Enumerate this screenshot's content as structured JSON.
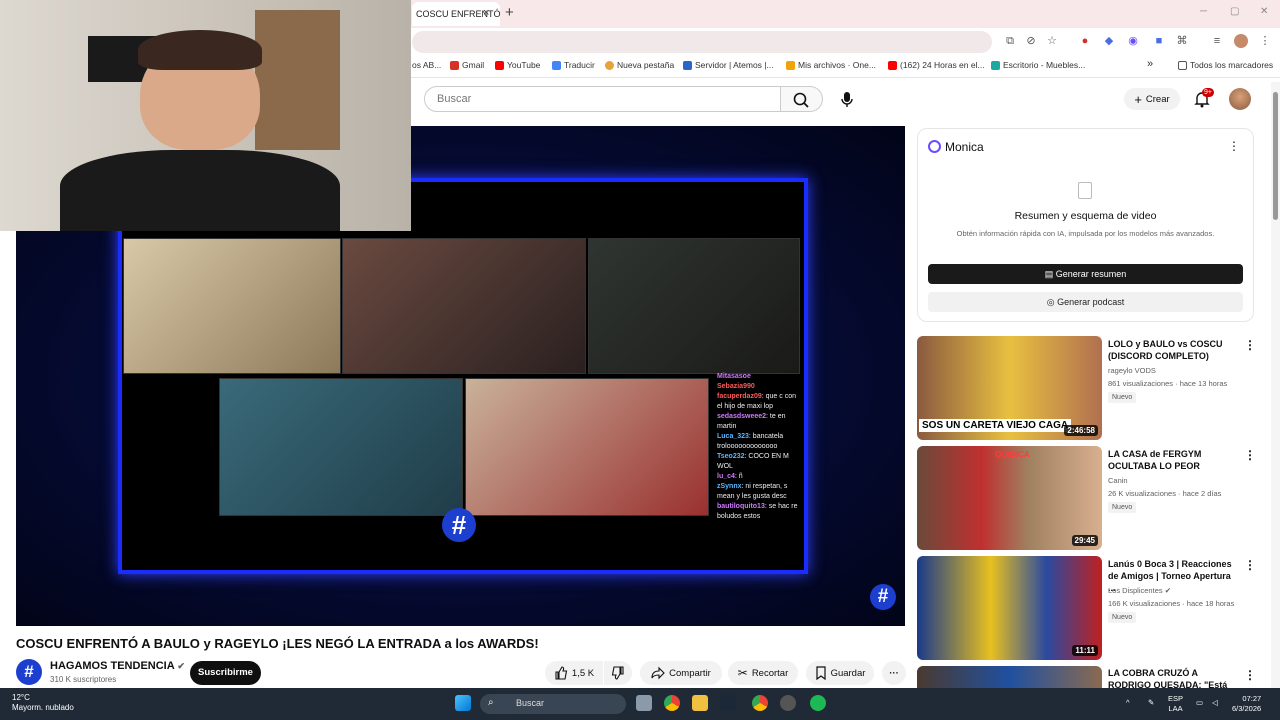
{
  "browser": {
    "tab_title": "COSCU ENFRENTÓ A BAULO",
    "tab_close": "×",
    "new_tab": "+",
    "bookmarks": [
      {
        "label": "os AB...",
        "color": "#888"
      },
      {
        "label": "Gmail",
        "color": "#d93025"
      },
      {
        "label": "YouTube",
        "color": "#ff0000"
      },
      {
        "label": "Traducir",
        "color": "#4285f4"
      },
      {
        "label": "Nueva pestaña",
        "color": "#e8a23a"
      },
      {
        "label": "Servidor | Atemos |...",
        "color": "#2b65c9"
      },
      {
        "label": "Mis archivos · One...",
        "color": "#f0a30a"
      },
      {
        "label": "(162) 24 Horas en el...",
        "color": "#ff0000"
      },
      {
        "label": "Escritorio - Muebles...",
        "color": "#19a9a0"
      }
    ],
    "bookmarks_more": "»",
    "all_bookmarks": "Todos los marcadores"
  },
  "youtube": {
    "search_placeholder": "Buscar",
    "create_label": "Crear",
    "notif_badge": "9+"
  },
  "video": {
    "title": "COSCU ENFRENTÓ A BAULO y RAGEYLO ¡LES NEGÓ LA ENTRADA a los AWARDS!",
    "logo_glyph": "#",
    "chat": [
      {
        "name": "Mitasasoe",
        "cls": "n",
        "text": ""
      },
      {
        "name": "Sebazia990",
        "cls": "n2",
        "text": ""
      },
      {
        "name": "facuperdaz09",
        "cls": "n2",
        "text": ": que c con el hijo de maxi lop"
      },
      {
        "name": "sedasdsweee2",
        "cls": "n",
        "text": ": te en martin"
      },
      {
        "name": "Luca_323",
        "cls": "n3",
        "text": ": bancatela trolooooooooooooo"
      },
      {
        "name": "Tseo232",
        "cls": "n3",
        "text": ": COCO EN M WOL"
      },
      {
        "name": "lu_c4",
        "cls": "n",
        "text": ": ñ"
      },
      {
        "name": "zSynnx",
        "cls": "n3",
        "text": ": ni respetan, s mean y les gusta desc"
      },
      {
        "name": "bautiloquito13",
        "cls": "n",
        "text": ": se hac re boludos estos"
      }
    ]
  },
  "channel": {
    "avatar_glyph": "#",
    "name": "HAGAMOS TENDENCIA",
    "verified": "✔",
    "subs": "310 K suscriptores",
    "subscribe": "Suscribirme"
  },
  "actions": {
    "likes": "1,5 K",
    "share": "Compartir",
    "clip": "Recortar",
    "save": "Guardar",
    "more": "···"
  },
  "monica": {
    "title": "Monica",
    "menu": "⋮",
    "heading": "Resumen y esquema de video",
    "subheading": "Obtén información rápida con IA, impulsada por los modelos más avanzados.",
    "gen_summary": "Generar resumen",
    "gen_podcast": "Generar podcast"
  },
  "recommendations": [
    {
      "title": "LOLO y BAULO vs COSCU (DISCORD COMPLETO)",
      "channel": "rageylo VODS",
      "meta": "861 visualizaciones · hace 13 horas",
      "badge": "Nuevo",
      "duration": "2:46:58",
      "overlay": "SOS UN CARETA   VIEJO CAGA"
    },
    {
      "title": "LA CASA de FERGYM OCULTABA LO PEOR",
      "channel": "Canin",
      "meta": "26 K visualizaciones · hace 2 días",
      "badge": "Nuevo",
      "duration": "29:45",
      "overlay": "QUIMICA"
    },
    {
      "title": "Lanús 0 Boca 3 | Reacciones de Amigos | Torneo Apertura ...",
      "channel": "Los Displicentes ✔",
      "meta": "166 K visualizaciones · hace 18 horas",
      "badge": "Nuevo",
      "duration": "11:11",
      "overlay": ""
    },
    {
      "title": "LA COBRA CRUZÓ A RODRIGO QUESADA: \"Está re dolido\"",
      "channel": "",
      "meta": "",
      "badge": "",
      "duration": "",
      "overlay": ""
    }
  ],
  "taskbar": {
    "temp": "12°C",
    "weather": "Mayorm. nublado",
    "search": "Buscar",
    "lang1": "ESP",
    "lang2": "LAA",
    "time": "07:27",
    "date": "6/3/2026"
  }
}
